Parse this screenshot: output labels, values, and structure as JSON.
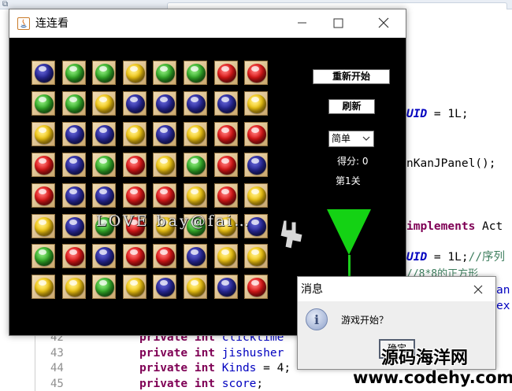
{
  "ide": {
    "lines": [
      {
        "number": "42",
        "parts": [
          [
            "kw",
            "private int "
          ],
          [
            "fld",
            "clicktime"
          ]
        ]
      },
      {
        "number": "43",
        "parts": [
          [
            "kw",
            "private int "
          ],
          [
            "fld",
            "jishusher"
          ]
        ]
      },
      {
        "number": "44",
        "parts": [
          [
            "kw",
            "private int "
          ],
          [
            "fld",
            "Kinds"
          ],
          [
            "plain",
            " = 4;"
          ]
        ]
      },
      {
        "number": "45",
        "parts": [
          [
            "kw",
            "private int "
          ],
          [
            "fld",
            "score"
          ],
          [
            "plain",
            ";"
          ]
        ]
      }
    ],
    "right_fragments": {
      "uid1": "UID",
      "uid1_rest": " = 1L;",
      "panel": "nKanJPanel();",
      "implements": "implements",
      "implements_rest": " Act",
      "uid2": "UID",
      "uid2_rest": " = 1L;",
      "uid2_comment": "//序列",
      "comment2": "//8*8的正方形",
      "frag_an": "an",
      "frag_ex": "ex"
    }
  },
  "game": {
    "title": "连连看",
    "board": [
      [
        "navy",
        "green",
        "green",
        "yellow",
        "green",
        "green",
        "red",
        "red"
      ],
      [
        "green",
        "green",
        "yellow",
        "navy",
        "navy",
        "navy",
        "navy",
        "yellow"
      ],
      [
        "yellow",
        "navy",
        "navy",
        "yellow",
        "navy",
        "yellow",
        "red",
        "red"
      ],
      [
        "red",
        "navy",
        "green",
        "red",
        "yellow",
        "green",
        "red",
        "navy"
      ],
      [
        "red",
        "navy",
        "navy",
        "red",
        "red",
        "yellow",
        "red",
        "yellow"
      ],
      [
        "yellow",
        "navy",
        "green",
        "red",
        "yellow",
        "green",
        "yellow",
        "navy"
      ],
      [
        "green",
        "red",
        "navy",
        "red",
        "red",
        "navy",
        "yellow",
        "yellow"
      ],
      [
        "yellow",
        "yellow",
        "green",
        "yellow",
        "navy",
        "yellow",
        "navy",
        "red"
      ]
    ],
    "restart_label": "重新开始",
    "refresh_label": "刷新",
    "difficulty_selected": "简单",
    "score_text": "得分: 0",
    "level_text": "第1关",
    "watermark": "LOVE bay@fai…",
    "colors": {
      "navy": "#2a2a9c",
      "green": "#36b02a",
      "yellow": "#f3c812",
      "red": "#e01818",
      "timer": "#1bcd1b"
    }
  },
  "dialog": {
    "title": "消息",
    "message": "游戏开始？",
    "ok_label": "确定",
    "icon": "info-icon"
  },
  "site": {
    "name": "源码海洋网",
    "url": "www.codehy.com"
  }
}
